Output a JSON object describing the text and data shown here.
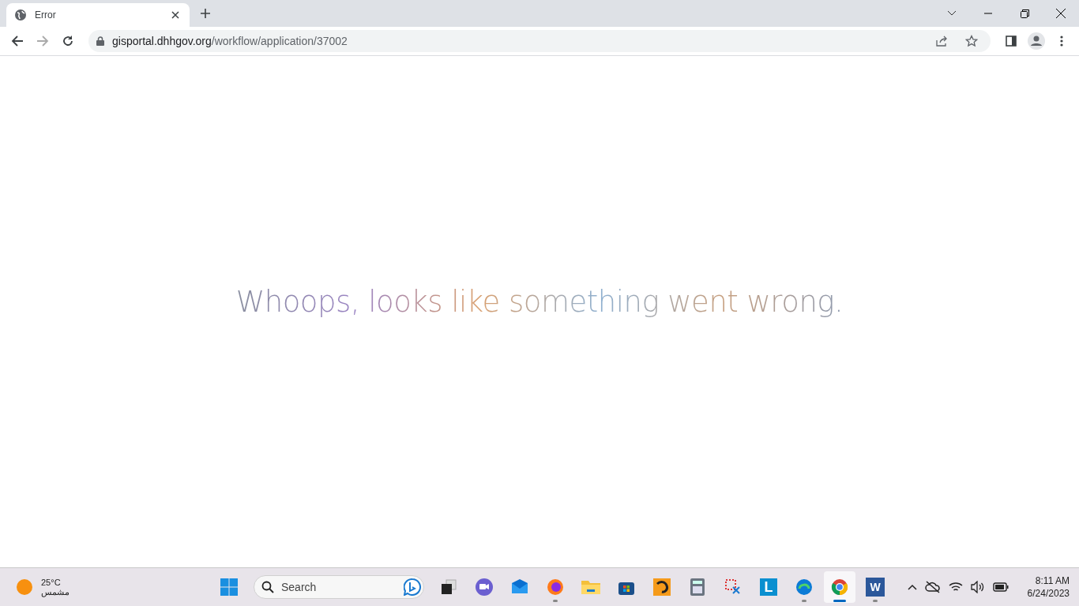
{
  "browser": {
    "tabs": [
      {
        "title": "Error",
        "selected": true
      }
    ],
    "url": {
      "host": "gisportal.dhhgov.org",
      "path": "/workflow/application/37002"
    }
  },
  "page": {
    "message": "Whoops, looks like something went wrong."
  },
  "taskbar": {
    "weather": {
      "temperature": "25°C",
      "condition": "مشمس"
    },
    "search": {
      "placeholder": "Search"
    },
    "apps": [
      {
        "kind": "taskview",
        "running": false,
        "selected": false
      },
      {
        "kind": "meet",
        "running": false,
        "selected": false
      },
      {
        "kind": "mail",
        "running": false,
        "selected": false
      },
      {
        "kind": "firefox",
        "running": true,
        "selected": false
      },
      {
        "kind": "folder",
        "running": false,
        "selected": false
      },
      {
        "kind": "store",
        "running": false,
        "selected": false
      },
      {
        "kind": "orange",
        "running": false,
        "selected": false
      },
      {
        "kind": "calculator",
        "running": false,
        "selected": false
      },
      {
        "kind": "snip",
        "running": false,
        "selected": false
      },
      {
        "kind": "letter",
        "glyph": "L",
        "running": false,
        "selected": false
      },
      {
        "kind": "edge",
        "running": true,
        "selected": false
      },
      {
        "kind": "chrome",
        "running": true,
        "selected": true
      },
      {
        "kind": "word",
        "glyph": "W",
        "running": true,
        "selected": false
      }
    ],
    "clock": {
      "time": "8:11 AM",
      "date": "6/24/2023"
    }
  }
}
